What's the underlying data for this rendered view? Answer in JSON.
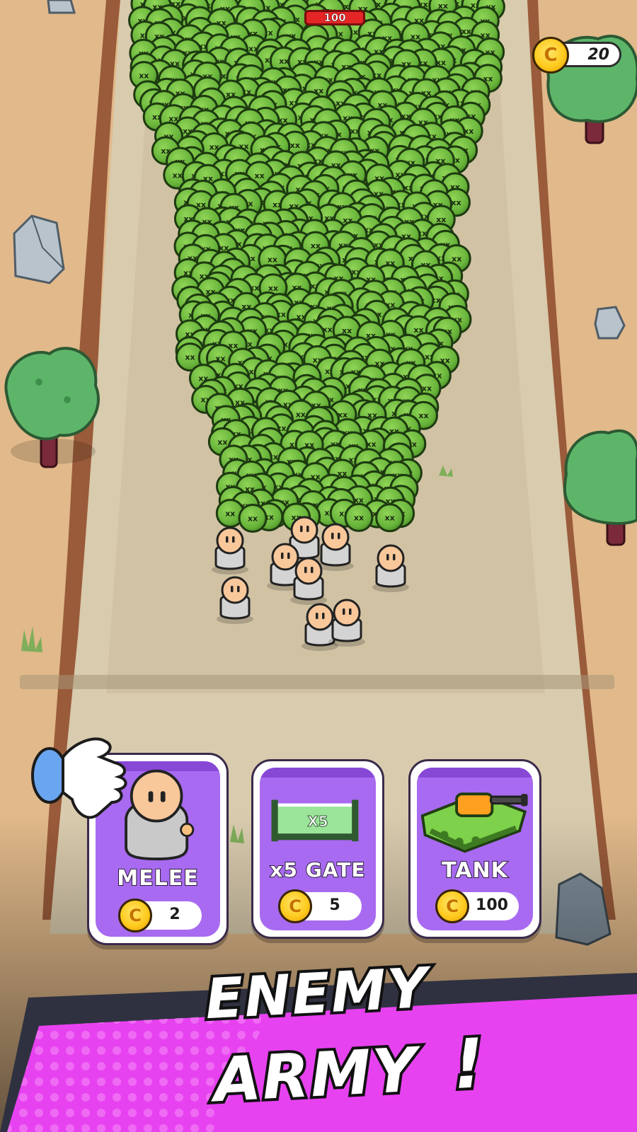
{
  "base": {
    "hp": "100"
  },
  "currency": {
    "amount": "20",
    "coin_symbol": "C",
    "coin_icon": "gold-coin-icon"
  },
  "cards": [
    {
      "id": "melee",
      "label": "MELEE",
      "price": "2",
      "icon": "melee-soldier-icon"
    },
    {
      "id": "gate",
      "label": "x5  GATE",
      "price": "5",
      "icon": "multiplier-gate-icon",
      "gate_text": "X5"
    },
    {
      "id": "tank",
      "label": "TANK",
      "price": "100",
      "icon": "tank-icon"
    }
  ],
  "banner": {
    "line1": "ENEMY",
    "line2": "ARMY",
    "punct": "!"
  },
  "colors": {
    "card_purple": "#a86af0",
    "banner_magenta": "#e742f0",
    "zombie_green": "#6cb83a",
    "coin_gold": "#ffcb1f",
    "hp_red": "#e52626"
  }
}
